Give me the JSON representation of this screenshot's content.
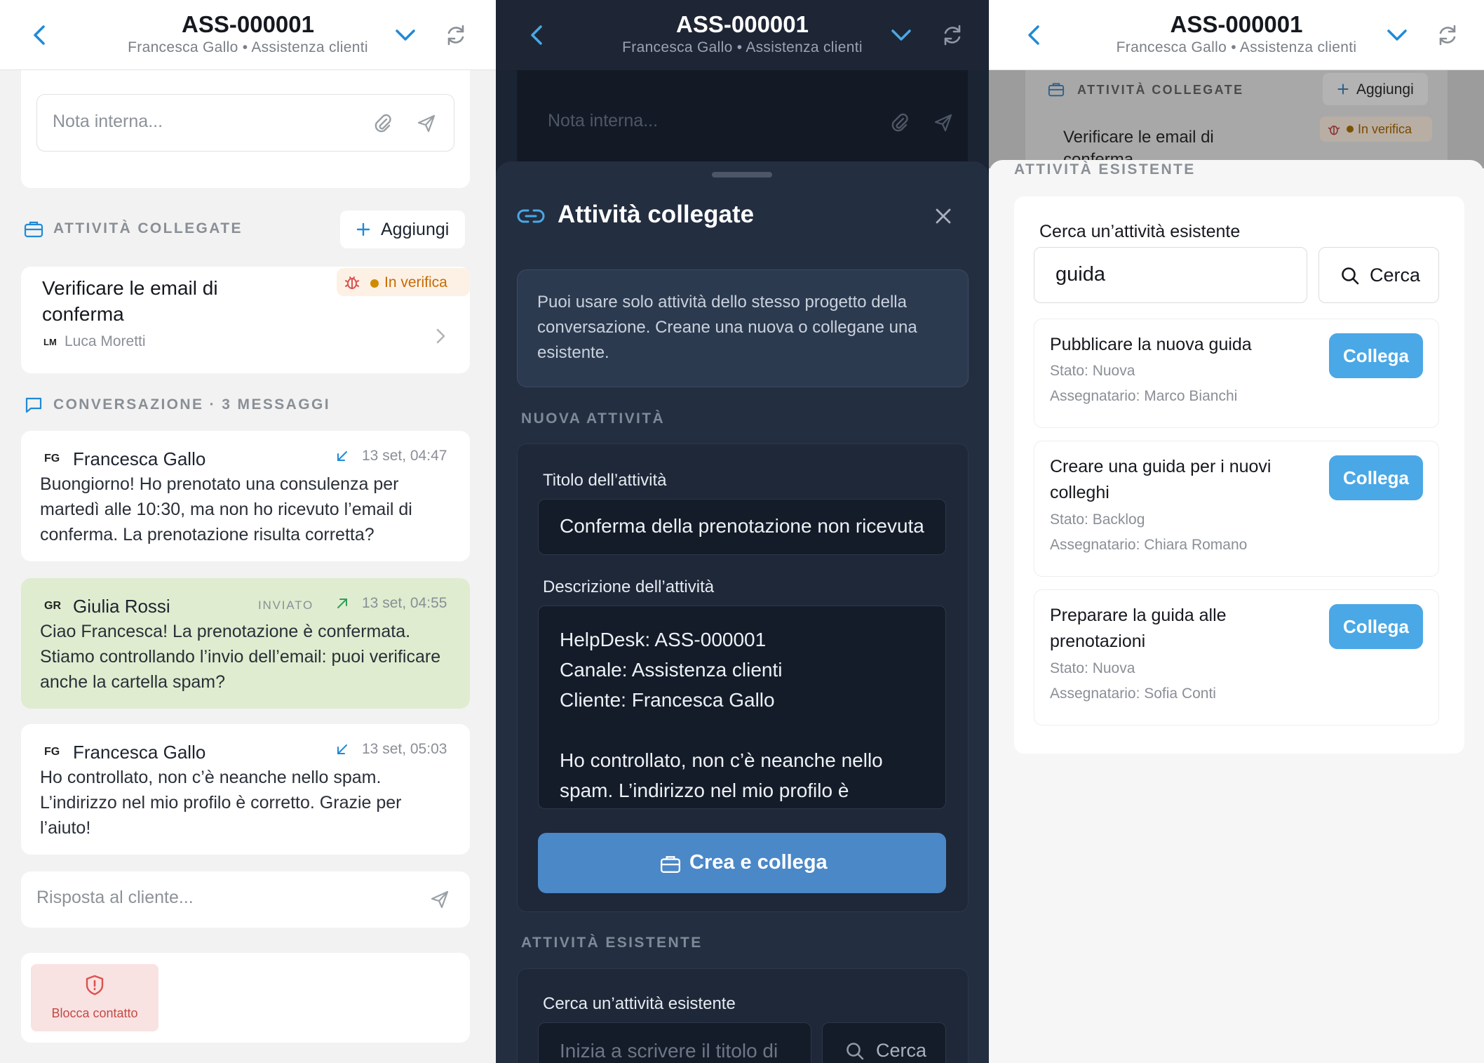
{
  "header": {
    "title": "ASS-000001",
    "subtitle": "Francesca Gallo • Assistenza clienti"
  },
  "left": {
    "internal_note_placeholder": "Nota interna...",
    "linked_label": "ATTIVITÀ COLLEGATE",
    "add_label": "Aggiungi",
    "task": {
      "title": "Verificare le email di conferma",
      "status": "In verifica",
      "assignee_initials": "LM",
      "assignee": "Luca Moretti"
    },
    "conversation_label": "CONVERSAZIONE · 3 MESSAGGI",
    "messages": [
      {
        "initials": "FG",
        "name": "Francesca Gallo",
        "sent": "",
        "time": "13 set, 04:47",
        "text": "Buongiorno! Ho prenotato una consulenza per martedì alle 10:30, ma non ho ricevuto l’email di conferma. La prenotazione risulta corretta?"
      },
      {
        "initials": "GR",
        "name": "Giulia Rossi",
        "sent": "INVIATO",
        "time": "13 set, 04:55",
        "text": "Ciao Francesca! La prenotazione è confermata. Stiamo controllando l’invio dell’email: puoi verificare anche la cartella spam?"
      },
      {
        "initials": "FG",
        "name": "Francesca Gallo",
        "sent": "",
        "time": "13 set, 05:03",
        "text": "Ho controllato, non c’è neanche nello spam. L’indirizzo nel mio profilo è corretto. Grazie per l’aiuto!"
      }
    ],
    "reply_placeholder": "Risposta al cliente...",
    "block_label": "Blocca contatto"
  },
  "middle": {
    "sheet_title": "Attività collegate",
    "info": "Puoi usare solo attività dello stesso progetto della conversazione. Creane una nuova o collegane una esistente.",
    "new_section": "NUOVA ATTIVITÀ",
    "title_label": "Titolo dell’attività",
    "title_value": "Conferma della prenotazione non ricevuta",
    "desc_label": "Descrizione dell’attività",
    "desc_lines": [
      "HelpDesk: ASS-000001",
      "Canale: Assistenza clienti",
      "Cliente: Francesca Gallo",
      "",
      "Ho controllato, non c’è neanche nello",
      "spam. L’indirizzo nel mio profilo è"
    ],
    "create_button": "Crea e collega",
    "existing_section": "ATTIVITÀ ESISTENTE",
    "search_label": "Cerca un’attività esistente",
    "search_placeholder": "Inizia a scrivere il titolo di",
    "search_button": "Cerca"
  },
  "right": {
    "existing_section": "ATTIVITÀ ESISTENTE",
    "search_label": "Cerca un’attività esistente",
    "search_value": "guida",
    "search_button": "Cerca",
    "link_button": "Collega",
    "results": [
      {
        "title": "Pubblicare la nuova guida",
        "status": "Stato: Nuova",
        "assignee": "Assegnatario: Marco Bianchi"
      },
      {
        "title": "Creare una guida per i nuovi colleghi",
        "status": "Stato: Backlog",
        "assignee": "Assegnatario: Chiara Romano"
      },
      {
        "title": "Preparare la guida alle prenotazioni",
        "status": "Stato: Nuova",
        "assignee": "Assegnatario: Sofia Conti"
      }
    ]
  },
  "colors": {
    "accent": "#1f8ad8",
    "collega": "#4aa8e6",
    "create": "#4a88c8",
    "sent_bubble": "#dfeccf",
    "status_bg": "#fdf1e6",
    "status_text": "#c66a00",
    "danger": "#d9534f"
  },
  "icons": [
    "back-chevron-icon",
    "chevron-down-icon",
    "refresh-icon",
    "paperclip-icon",
    "send-icon",
    "briefcase-icon",
    "plus-icon",
    "bug-icon",
    "chevron-right-icon",
    "chat-icon",
    "incoming-arrow-icon",
    "outgoing-arrow-icon",
    "shield-alert-icon",
    "link-icon",
    "close-icon",
    "search-icon"
  ]
}
